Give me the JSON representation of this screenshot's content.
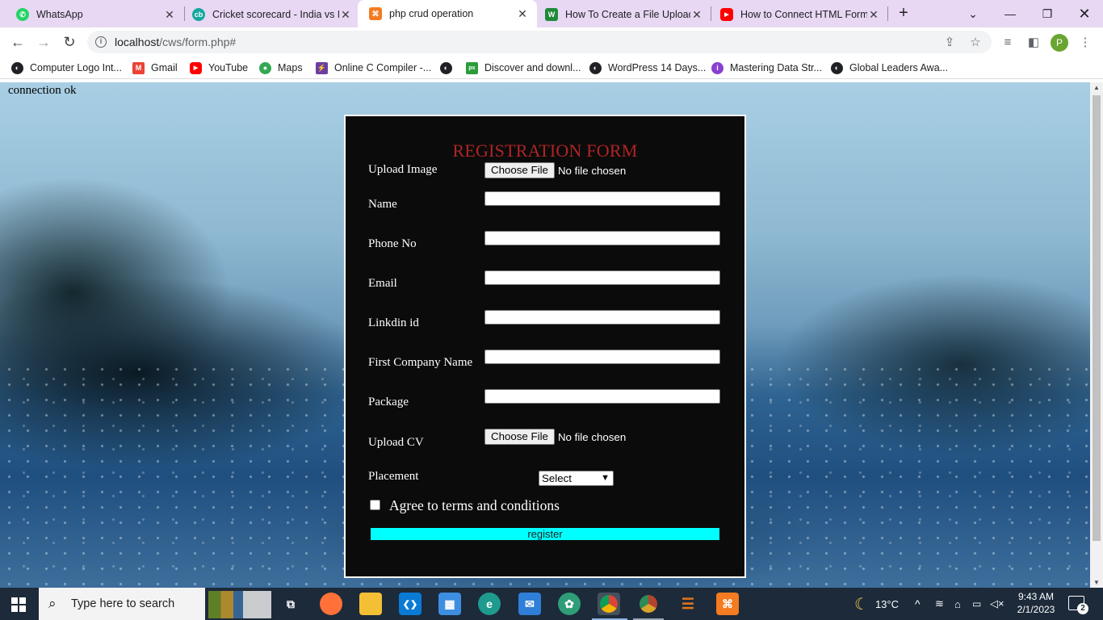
{
  "browser": {
    "tabs": [
      {
        "title": "WhatsApp",
        "icon": "whatsapp-icon",
        "color": "#25d366",
        "glyph": "✆"
      },
      {
        "title": "Cricket scorecard - India vs N",
        "icon": "cricbuzz-icon",
        "color": "#13a89e",
        "glyph": "cb"
      },
      {
        "title": "php crud operation",
        "icon": "xampp-icon",
        "color": "#f47b20",
        "glyph": "⌘"
      },
      {
        "title": "How To Create a File Upload",
        "icon": "w3-icon",
        "color": "#1e8a3a",
        "glyph": "W"
      },
      {
        "title": "How to Connect HTML Form",
        "icon": "youtube-icon",
        "color": "#ff0000",
        "glyph": "▶"
      }
    ],
    "close_glyph": "✕",
    "new_tab_glyph": "+",
    "url_host": "localhost",
    "url_path": "/cws/form.php#",
    "profile_initial": "P"
  },
  "bookmarks": [
    {
      "label": "Computer Logo Int...",
      "icon": "globe-icon",
      "color": "#202124",
      "glyph": "◐"
    },
    {
      "label": "Gmail",
      "icon": "gmail-icon",
      "color": "#ea4335",
      "glyph": "M"
    },
    {
      "label": "YouTube",
      "icon": "youtube-icon",
      "color": "#ff0000",
      "glyph": "▶"
    },
    {
      "label": "Maps",
      "icon": "maps-icon",
      "color": "#34a853",
      "glyph": "●"
    },
    {
      "label": "Online C Compiler -...",
      "icon": "compiler-icon",
      "color": "#6a3fa0",
      "glyph": "⚡"
    },
    {
      "label": "",
      "icon": "globe-icon",
      "color": "#202124",
      "glyph": "◐"
    },
    {
      "label": "Discover and downl...",
      "icon": "px-icon",
      "color": "#2a9d3b",
      "glyph": "px"
    },
    {
      "label": "WordPress 14 Days...",
      "icon": "globe-icon",
      "color": "#202124",
      "glyph": "◐"
    },
    {
      "label": "Mastering Data Str...",
      "icon": "mastering-icon",
      "color": "#8a3fd0",
      "glyph": "i"
    },
    {
      "label": "Global Leaders Awa...",
      "icon": "globe-icon",
      "color": "#202124",
      "glyph": "◐"
    }
  ],
  "page": {
    "connection_message": "connection ok",
    "form": {
      "title": "REGISTRATION FORM",
      "labels": {
        "upload_image": "Upload Image",
        "name": "Name",
        "phone": "Phone No",
        "email": "Email",
        "linkedin": "Linkdin id",
        "company": "First Company Name",
        "package": "Package",
        "upload_cv": "Upload CV",
        "placement": "Placement"
      },
      "file_button": "Choose File",
      "file_status": "No file chosen",
      "placement_selected": "Select",
      "terms": "Agree to terms and conditions",
      "register_label": "register",
      "register_color": "#00ffff",
      "title_color": "#b02424"
    }
  },
  "taskbar": {
    "search_placeholder": "Type here to search",
    "apps": [
      {
        "name": "task-view-icon",
        "glyph": "⧉",
        "color": "transparent"
      },
      {
        "name": "firefox-icon",
        "glyph": "●",
        "color": "#ff7139"
      },
      {
        "name": "file-explorer-icon",
        "glyph": "▭",
        "color": "#f3c035"
      },
      {
        "name": "vscode-icon",
        "glyph": "❮❯",
        "color": "#0a7bd5"
      },
      {
        "name": "store-icon",
        "glyph": "▦",
        "color": "#3d8ee0"
      },
      {
        "name": "edge-icon",
        "glyph": "e",
        "color": "#1f9a8f"
      },
      {
        "name": "mail-icon",
        "glyph": "✉",
        "color": "#2f7ed8"
      },
      {
        "name": "chatgpt-icon",
        "glyph": "✿",
        "color": "#2f9e78"
      },
      {
        "name": "chrome-icon",
        "glyph": "◉",
        "color": "#db4437"
      },
      {
        "name": "chrome-profile-icon",
        "glyph": "◉",
        "color": "#b4432d"
      },
      {
        "name": "eclipse-icon",
        "glyph": "☰",
        "color": "#e2741c"
      },
      {
        "name": "xampp-icon",
        "glyph": "⌘",
        "color": "#f47b20"
      }
    ],
    "weather": "13°C",
    "time": "9:43 AM",
    "date": "2/1/2023",
    "notification_count": "2"
  }
}
